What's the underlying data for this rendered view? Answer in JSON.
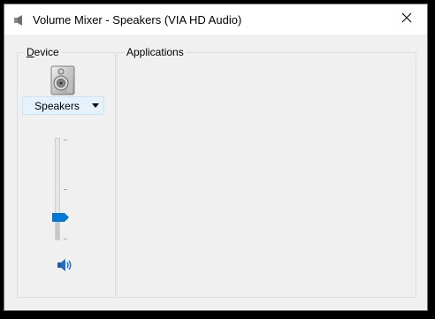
{
  "window": {
    "title": "Volume Mixer - Speakers (VIA HD Audio)",
    "title_icon": "speaker-icon",
    "close_glyph": "✕"
  },
  "device": {
    "group_label_accel": "D",
    "group_label_rest": "evice",
    "device_icon": "speaker-device-icon",
    "selected": "Speakers",
    "volume_percent": 25,
    "mute_icon": "speaker-volume-icon"
  },
  "applications": {
    "group_label": "Applications"
  },
  "colors": {
    "accent": "#0078d7",
    "group_border": "#d5dfe5",
    "select_bg": "#e5f1fb"
  }
}
